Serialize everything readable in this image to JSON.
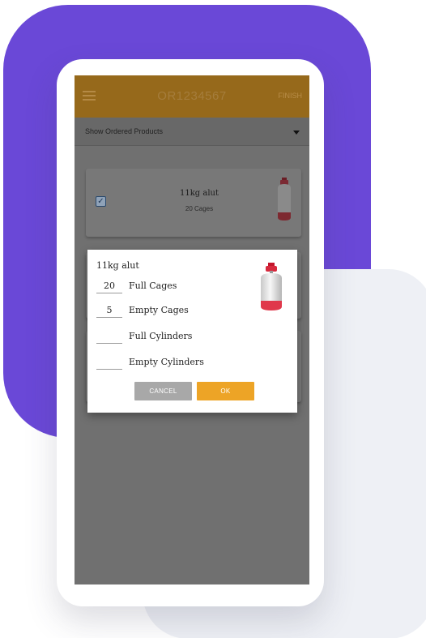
{
  "appbar": {
    "title": "OR1234567",
    "finish_label": "FINISH"
  },
  "filter": {
    "selected": "Show Ordered Products"
  },
  "cards": [
    {
      "name": "11kg alut",
      "quantity": "20 Cages",
      "checked": true
    }
  ],
  "dialog": {
    "title": "11kg alut",
    "rows": [
      {
        "value": "20",
        "label": "Full Cages"
      },
      {
        "value": "5",
        "label": "Empty Cages"
      },
      {
        "value": "",
        "label": "Full Cylinders"
      },
      {
        "value": "",
        "label": "Empty Cylinders"
      }
    ],
    "cancel_label": "CANCEL",
    "ok_label": "OK"
  },
  "colors": {
    "accent": "#eda426",
    "appbar_dimmed": "#96691b",
    "backdrop_purple": "#6a48d7",
    "cylinder_cap": "#e0384b"
  },
  "icons": {
    "menu": "hamburger-icon",
    "dropdown": "caret-down-icon",
    "product": "gas-cylinder-icon",
    "checkbox": "checkmark-icon"
  }
}
